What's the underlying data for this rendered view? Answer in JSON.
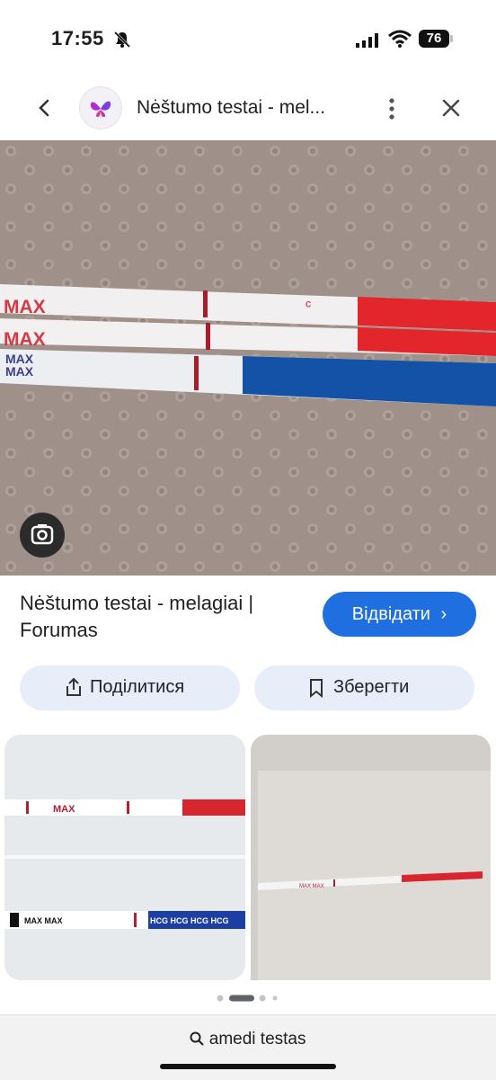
{
  "status_bar": {
    "time": "17:55",
    "battery": "76"
  },
  "top_bar": {
    "title": "Nėštumo testai - mel..."
  },
  "hero": {
    "strips": [
      {
        "label": "MAX",
        "handle_color": "#e2262b"
      },
      {
        "label": "MAX",
        "handle_color": "#e2262b"
      },
      {
        "label": "MAX",
        "handle_color": "#1447a8"
      }
    ]
  },
  "result": {
    "title": "Nėštumo testai - melagiai | Forumas",
    "visit_label": "Відвідати"
  },
  "actions": {
    "share_label": "Поділитися",
    "save_label": "Зберегти"
  },
  "related": [
    {
      "strips": [
        {
          "label": "MAX"
        },
        {
          "label": "MAX MAX",
          "handle_text": "HCG HCG HCG HCG"
        }
      ]
    },
    {
      "strip": {
        "label": "MAX MAX"
      }
    }
  ],
  "carousel": {
    "total": 4,
    "active": 1
  },
  "bottom_bar": {
    "query": "amedi testas"
  },
  "colors": {
    "accent": "#1f6fe0",
    "pill_bg": "#e7eef9",
    "red": "#e2262b",
    "blue": "#1447a8"
  }
}
